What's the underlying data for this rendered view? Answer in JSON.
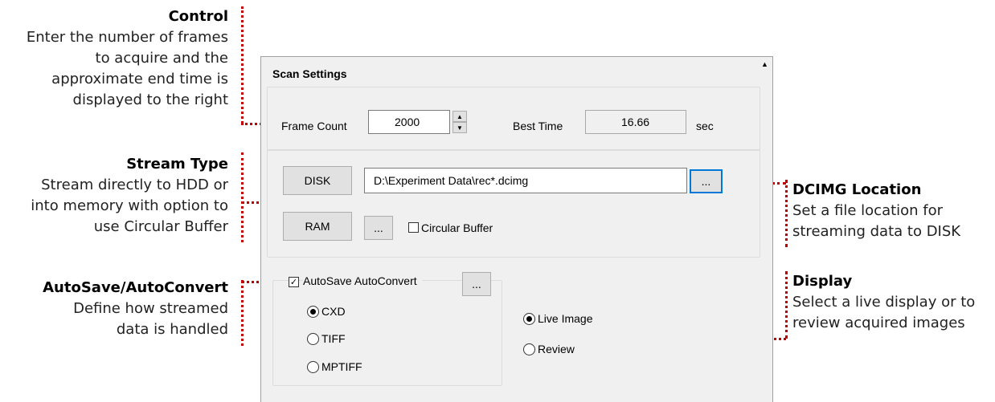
{
  "annotations": {
    "control": {
      "title": "Control",
      "lines": [
        "Enter the number of frames",
        "to acquire and the",
        "approximate end time is",
        "displayed to the right"
      ]
    },
    "stream_type": {
      "title": "Stream Type",
      "lines": [
        "Stream directly to HDD or",
        "into memory with option to",
        "use Circular Buffer"
      ]
    },
    "autosave": {
      "title": "AutoSave/AutoConvert",
      "lines": [
        "Define how streamed",
        "data is handled"
      ]
    },
    "dcimg_location": {
      "title": "DCIMG Location",
      "lines": [
        "Set a file location for",
        "streaming data to DISK"
      ]
    },
    "display": {
      "title": "Display",
      "lines": [
        "Select a live display or to",
        "review acquired images"
      ]
    }
  },
  "panel": {
    "title": "Scan Settings",
    "collapse_glyph": "▲",
    "frame_count": {
      "label": "Frame Count",
      "value": "2000",
      "up": "▲",
      "down": "▼"
    },
    "best_time": {
      "label": "Best Time",
      "value": "16.66",
      "unit": "sec"
    },
    "disk": {
      "button": "DISK",
      "path": "D:\\Experiment Data\\rec*.dcimg",
      "browse": "..."
    },
    "ram": {
      "button": "RAM",
      "browse": "...",
      "circular_buffer": {
        "label": "Circular Buffer",
        "checked": false
      }
    },
    "autosave": {
      "label": "AutoSave AutoConvert",
      "checked": true,
      "browse": "...",
      "formats": [
        {
          "label": "CXD",
          "selected": true
        },
        {
          "label": "TIFF",
          "selected": false
        },
        {
          "label": "MPTIFF",
          "selected": false
        }
      ]
    },
    "display": {
      "options": [
        {
          "label": "Live Image",
          "selected": true
        },
        {
          "label": "Review",
          "selected": false
        }
      ]
    }
  },
  "colors": {
    "annotation_line": "#c00000",
    "focus_border": "#0078d7",
    "panel_bg": "#f0f0f0"
  }
}
